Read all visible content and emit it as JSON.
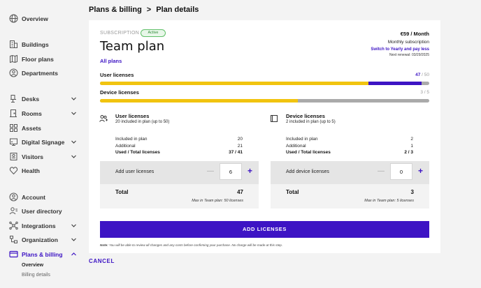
{
  "sidebar": {
    "items": [
      {
        "label": "Overview",
        "icon": "globe-icon"
      },
      {
        "label": "Buildings",
        "icon": "building-icon"
      },
      {
        "label": "Floor plans",
        "icon": "map-icon"
      },
      {
        "label": "Departments",
        "icon": "departments-icon"
      },
      {
        "label": "Desks",
        "icon": "desk-icon"
      },
      {
        "label": "Rooms",
        "icon": "door-icon"
      },
      {
        "label": "Assets",
        "icon": "assets-icon"
      },
      {
        "label": "Digital Signage",
        "icon": "signage-icon"
      },
      {
        "label": "Visitors",
        "icon": "visitors-icon"
      },
      {
        "label": "Health",
        "icon": "health-icon"
      },
      {
        "label": "Account",
        "icon": "account-icon"
      },
      {
        "label": "User directory",
        "icon": "user-directory-icon"
      },
      {
        "label": "Integrations",
        "icon": "integrations-icon"
      },
      {
        "label": "Organization",
        "icon": "organization-icon"
      },
      {
        "label": "Plans & billing",
        "icon": "card-icon"
      }
    ],
    "sub_items": [
      {
        "label": "Overview"
      },
      {
        "label": "Billing details"
      }
    ]
  },
  "breadcrumb": {
    "parent": "Plans & billing",
    "separator": ">",
    "current": "Plan details"
  },
  "plan": {
    "subscription_label": "SUBSCRIPTION",
    "status": "Active",
    "name": "Team plan",
    "all_plans": "All plans",
    "price": "€59 / Month",
    "billing_period": "Monthly subscription",
    "switch_link": "Switch to Yearly and pay less",
    "renewal": "Next renewal: 03/29/2025"
  },
  "usage": {
    "user": {
      "label": "User licenses",
      "used": "47",
      "sep": " / ",
      "total": "50",
      "included_fraction": 0.816,
      "additional_fraction": 0.16
    },
    "device": {
      "label": "Device licenses",
      "count": "3 / 5",
      "fraction": 0.6
    }
  },
  "user_section": {
    "title": "User licenses",
    "desc": "20 included in plan (up to 50)",
    "rows": [
      {
        "label": "Included in plan",
        "value": "20"
      },
      {
        "label": "Additional",
        "value": "21"
      },
      {
        "label": "Used / Total licenses",
        "value": "37 / 41"
      }
    ],
    "add_label": "Add user licenses",
    "minus": "—",
    "plus": "+",
    "stepper_value": "6",
    "total_label": "Total",
    "total_value": "47",
    "max_note": "Max in Team plan: 50 licenses"
  },
  "device_section": {
    "title": "Device licenses",
    "desc": "2 included in plan (up to 5)",
    "rows": [
      {
        "label": "Included in plan",
        "value": "2"
      },
      {
        "label": "Additional",
        "value": "1"
      },
      {
        "label": "Used / Total licenses",
        "value": "2 / 3"
      }
    ],
    "add_label": "Add device licenses",
    "minus": "—",
    "plus": "+",
    "stepper_value": "0",
    "total_label": "Total",
    "total_value": "3",
    "max_note": "Max in Team plan: 5 licenses"
  },
  "cta": "ADD LICENSES",
  "note": {
    "bold": "Note:",
    "text": " You will be able to review all changes and any costs before confirming your purchase. No charge will be made at this step."
  },
  "cancel": "CANCEL",
  "colors": {
    "accent": "#3d14c4",
    "usage_yellow": "#f1c40f",
    "active_green": "#2e8a37"
  }
}
